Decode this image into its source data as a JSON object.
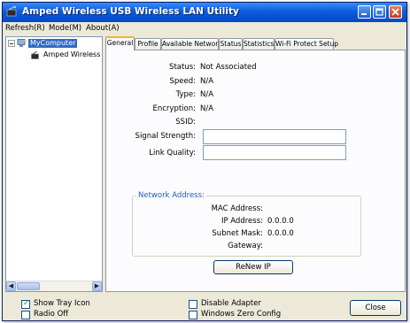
{
  "window": {
    "title": "Amped Wireless USB Wireless LAN Utility"
  },
  "menu": [
    "Refresh(R)",
    "Mode(M)",
    "About(A)"
  ],
  "tree": {
    "root": "MyComputer",
    "child": "Amped Wireless"
  },
  "tabs": [
    "General",
    "Profile",
    "Available Network",
    "Status",
    "Statistics",
    "Wi-Fi Protect Setup"
  ],
  "active_tab": "General",
  "general": {
    "status_label": "Status:",
    "status_value": "Not Associated",
    "speed_label": "Speed:",
    "speed_value": "N/A",
    "type_label": "Type:",
    "type_value": "N/A",
    "encryption_label": "Encryption:",
    "encryption_value": "N/A",
    "ssid_label": "SSID:",
    "ssid_value": "",
    "signal_label": "Signal Strength:",
    "link_label": "Link Quality:"
  },
  "network": {
    "legend": "Network Address:",
    "mac_label": "MAC Address:",
    "mac_value": "",
    "ip_label": "IP Address:",
    "ip_value": "0.0.0.0",
    "mask_label": "Subnet Mask:",
    "mask_value": "0.0.0.0",
    "gateway_label": "Gateway:",
    "gateway_value": ""
  },
  "renew_button": "ReNew IP",
  "options": {
    "show_tray_icon": "Show Tray Icon",
    "radio_off": "Radio Off",
    "disable_adapter": "Disable Adapter",
    "windows_zero_config": "Windows Zero Config"
  },
  "close_button": "Close",
  "icons": {
    "app": "wireless-app-icon",
    "computer": "computer-icon",
    "adapter": "wireless-adapter-icon",
    "minimize": "minimize-icon",
    "maximize": "maximize-icon",
    "close": "close-icon"
  },
  "colors": {
    "titlebar": "#0a5ce0",
    "selection": "#316ac5",
    "group_legend": "#1f5bc4",
    "active_tab_accent": "#f0b33c",
    "close_button": "#c33c15"
  }
}
